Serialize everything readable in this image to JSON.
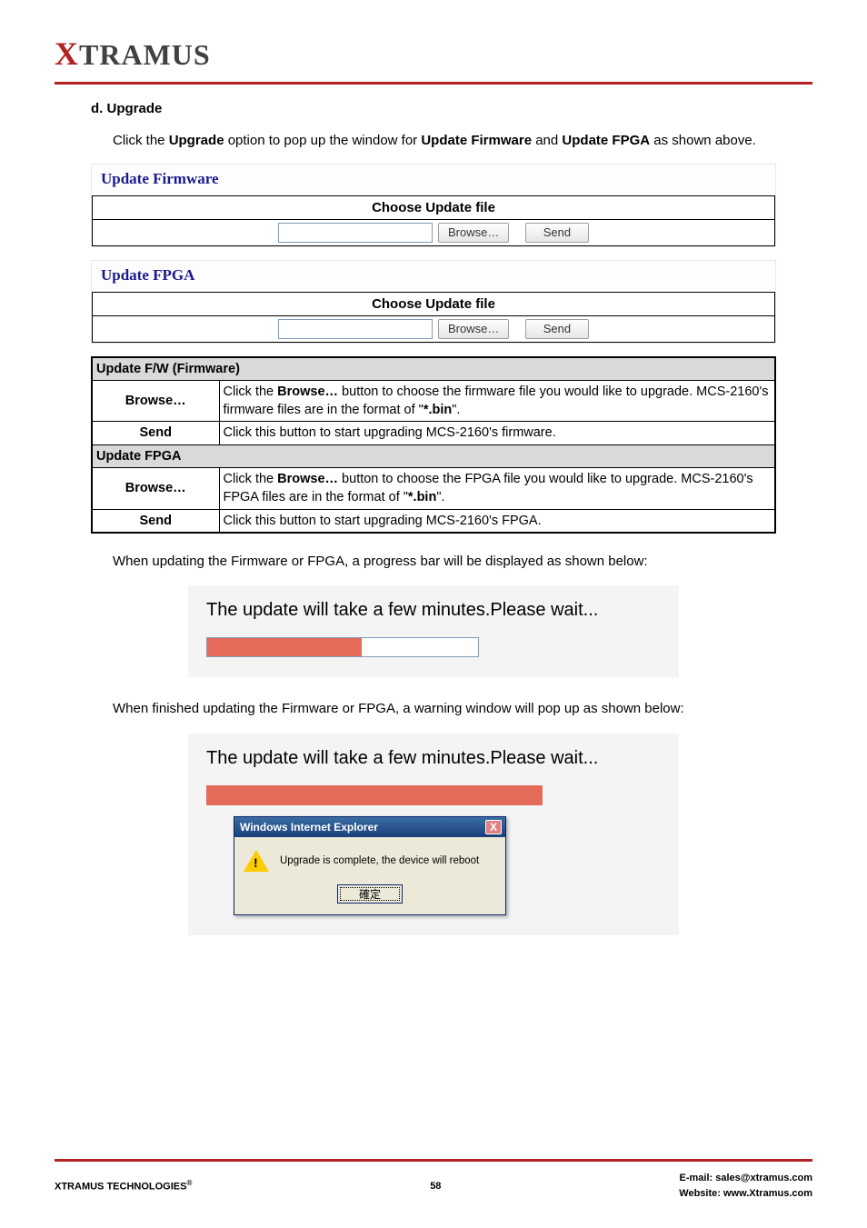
{
  "logo": {
    "x": "X",
    "rest": "TRAMUS"
  },
  "heading": "d. Upgrade",
  "intro": {
    "p1a": "Click the ",
    "p1b": "Upgrade",
    "p1c": " option to pop up the window for ",
    "p1d": "Update Firmware",
    "p1e": " and ",
    "p1f": "Update FPGA",
    "p1g": " as shown above."
  },
  "panel1": {
    "title": "Update Firmware",
    "choose": "Choose Update file",
    "browse": "Browse…",
    "send": "Send"
  },
  "panel2": {
    "title": "Update FPGA",
    "choose": "Choose Update file",
    "browse": "Browse…",
    "send": "Send"
  },
  "table": {
    "hdr1": "Update F/W (Firmware)",
    "r1_label": "Browse…",
    "r1_a": "Click the ",
    "r1_b": "Browse…",
    "r1_c": " button to choose the firmware file you would like to upgrade. MCS-2160's firmware files are in the format of \"",
    "r1_d": "*.bin",
    "r1_e": "\".",
    "r2_label": "Send",
    "r2_text": "Click this button to start upgrading MCS-2160's firmware.",
    "hdr2": "Update FPGA",
    "r3_label": "Browse…",
    "r3_a": "Click the ",
    "r3_b": "Browse…",
    "r3_c": " button to choose the FPGA file you would like to upgrade. MCS-2160's FPGA files are in the format of \"",
    "r3_d": "*.bin",
    "r3_e": "\".",
    "r4_label": "Send",
    "r4_text": "Click this button to start upgrading MCS-2160's FPGA."
  },
  "progress_intro": "When updating the Firmware or FPGA, a progress bar will be displayed as shown below:",
  "progress_text": "The update will take a few minutes.Please wait...",
  "dialog_intro": "When finished updating the Firmware or FPGA, a warning window will pop up as shown below:",
  "dialog": {
    "title": "Windows Internet Explorer",
    "close": "X",
    "message": "Upgrade is complete, the device will reboot",
    "ok": "確定"
  },
  "footer": {
    "left": "XTRAMUS TECHNOLOGIES",
    "reg": "®",
    "page": "58",
    "email_label": "E-mail: ",
    "email": "sales@xtramus.com",
    "web_label": "Website:  ",
    "web": "www.Xtramus.com"
  }
}
